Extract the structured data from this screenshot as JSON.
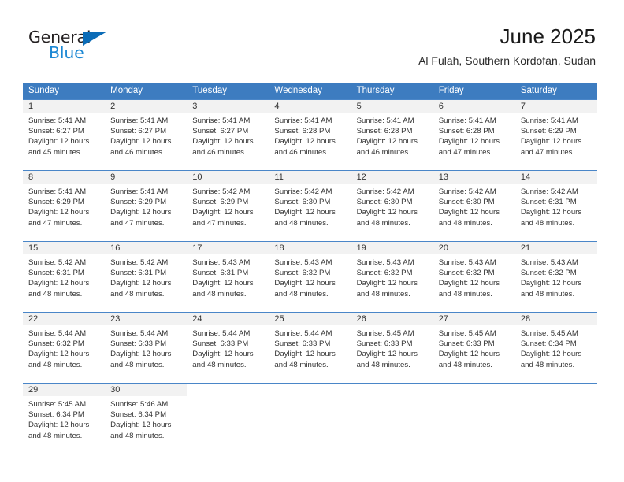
{
  "brand": {
    "name_part1": "General",
    "name_part2": "Blue",
    "triangle_icon": "triangle-icon",
    "accent_color": "#1c88d4"
  },
  "header": {
    "title": "June 2025",
    "subtitle": "Al Fulah, Southern Kordofan, Sudan"
  },
  "calendar": {
    "header_bg": "#3d7cc0",
    "daynum_bg": "#f2f2f2",
    "grid_line": "#4a86c8",
    "weekday_headers": [
      "Sunday",
      "Monday",
      "Tuesday",
      "Wednesday",
      "Thursday",
      "Friday",
      "Saturday"
    ],
    "weeks": [
      [
        {
          "day": "1",
          "sunrise": "Sunrise: 5:41 AM",
          "sunset": "Sunset: 6:27 PM",
          "daylight1": "Daylight: 12 hours",
          "daylight2": "and 45 minutes."
        },
        {
          "day": "2",
          "sunrise": "Sunrise: 5:41 AM",
          "sunset": "Sunset: 6:27 PM",
          "daylight1": "Daylight: 12 hours",
          "daylight2": "and 46 minutes."
        },
        {
          "day": "3",
          "sunrise": "Sunrise: 5:41 AM",
          "sunset": "Sunset: 6:27 PM",
          "daylight1": "Daylight: 12 hours",
          "daylight2": "and 46 minutes."
        },
        {
          "day": "4",
          "sunrise": "Sunrise: 5:41 AM",
          "sunset": "Sunset: 6:28 PM",
          "daylight1": "Daylight: 12 hours",
          "daylight2": "and 46 minutes."
        },
        {
          "day": "5",
          "sunrise": "Sunrise: 5:41 AM",
          "sunset": "Sunset: 6:28 PM",
          "daylight1": "Daylight: 12 hours",
          "daylight2": "and 46 minutes."
        },
        {
          "day": "6",
          "sunrise": "Sunrise: 5:41 AM",
          "sunset": "Sunset: 6:28 PM",
          "daylight1": "Daylight: 12 hours",
          "daylight2": "and 47 minutes."
        },
        {
          "day": "7",
          "sunrise": "Sunrise: 5:41 AM",
          "sunset": "Sunset: 6:29 PM",
          "daylight1": "Daylight: 12 hours",
          "daylight2": "and 47 minutes."
        }
      ],
      [
        {
          "day": "8",
          "sunrise": "Sunrise: 5:41 AM",
          "sunset": "Sunset: 6:29 PM",
          "daylight1": "Daylight: 12 hours",
          "daylight2": "and 47 minutes."
        },
        {
          "day": "9",
          "sunrise": "Sunrise: 5:41 AM",
          "sunset": "Sunset: 6:29 PM",
          "daylight1": "Daylight: 12 hours",
          "daylight2": "and 47 minutes."
        },
        {
          "day": "10",
          "sunrise": "Sunrise: 5:42 AM",
          "sunset": "Sunset: 6:29 PM",
          "daylight1": "Daylight: 12 hours",
          "daylight2": "and 47 minutes."
        },
        {
          "day": "11",
          "sunrise": "Sunrise: 5:42 AM",
          "sunset": "Sunset: 6:30 PM",
          "daylight1": "Daylight: 12 hours",
          "daylight2": "and 48 minutes."
        },
        {
          "day": "12",
          "sunrise": "Sunrise: 5:42 AM",
          "sunset": "Sunset: 6:30 PM",
          "daylight1": "Daylight: 12 hours",
          "daylight2": "and 48 minutes."
        },
        {
          "day": "13",
          "sunrise": "Sunrise: 5:42 AM",
          "sunset": "Sunset: 6:30 PM",
          "daylight1": "Daylight: 12 hours",
          "daylight2": "and 48 minutes."
        },
        {
          "day": "14",
          "sunrise": "Sunrise: 5:42 AM",
          "sunset": "Sunset: 6:31 PM",
          "daylight1": "Daylight: 12 hours",
          "daylight2": "and 48 minutes."
        }
      ],
      [
        {
          "day": "15",
          "sunrise": "Sunrise: 5:42 AM",
          "sunset": "Sunset: 6:31 PM",
          "daylight1": "Daylight: 12 hours",
          "daylight2": "and 48 minutes."
        },
        {
          "day": "16",
          "sunrise": "Sunrise: 5:42 AM",
          "sunset": "Sunset: 6:31 PM",
          "daylight1": "Daylight: 12 hours",
          "daylight2": "and 48 minutes."
        },
        {
          "day": "17",
          "sunrise": "Sunrise: 5:43 AM",
          "sunset": "Sunset: 6:31 PM",
          "daylight1": "Daylight: 12 hours",
          "daylight2": "and 48 minutes."
        },
        {
          "day": "18",
          "sunrise": "Sunrise: 5:43 AM",
          "sunset": "Sunset: 6:32 PM",
          "daylight1": "Daylight: 12 hours",
          "daylight2": "and 48 minutes."
        },
        {
          "day": "19",
          "sunrise": "Sunrise: 5:43 AM",
          "sunset": "Sunset: 6:32 PM",
          "daylight1": "Daylight: 12 hours",
          "daylight2": "and 48 minutes."
        },
        {
          "day": "20",
          "sunrise": "Sunrise: 5:43 AM",
          "sunset": "Sunset: 6:32 PM",
          "daylight1": "Daylight: 12 hours",
          "daylight2": "and 48 minutes."
        },
        {
          "day": "21",
          "sunrise": "Sunrise: 5:43 AM",
          "sunset": "Sunset: 6:32 PM",
          "daylight1": "Daylight: 12 hours",
          "daylight2": "and 48 minutes."
        }
      ],
      [
        {
          "day": "22",
          "sunrise": "Sunrise: 5:44 AM",
          "sunset": "Sunset: 6:32 PM",
          "daylight1": "Daylight: 12 hours",
          "daylight2": "and 48 minutes."
        },
        {
          "day": "23",
          "sunrise": "Sunrise: 5:44 AM",
          "sunset": "Sunset: 6:33 PM",
          "daylight1": "Daylight: 12 hours",
          "daylight2": "and 48 minutes."
        },
        {
          "day": "24",
          "sunrise": "Sunrise: 5:44 AM",
          "sunset": "Sunset: 6:33 PM",
          "daylight1": "Daylight: 12 hours",
          "daylight2": "and 48 minutes."
        },
        {
          "day": "25",
          "sunrise": "Sunrise: 5:44 AM",
          "sunset": "Sunset: 6:33 PM",
          "daylight1": "Daylight: 12 hours",
          "daylight2": "and 48 minutes."
        },
        {
          "day": "26",
          "sunrise": "Sunrise: 5:45 AM",
          "sunset": "Sunset: 6:33 PM",
          "daylight1": "Daylight: 12 hours",
          "daylight2": "and 48 minutes."
        },
        {
          "day": "27",
          "sunrise": "Sunrise: 5:45 AM",
          "sunset": "Sunset: 6:33 PM",
          "daylight1": "Daylight: 12 hours",
          "daylight2": "and 48 minutes."
        },
        {
          "day": "28",
          "sunrise": "Sunrise: 5:45 AM",
          "sunset": "Sunset: 6:34 PM",
          "daylight1": "Daylight: 12 hours",
          "daylight2": "and 48 minutes."
        }
      ],
      [
        {
          "day": "29",
          "sunrise": "Sunrise: 5:45 AM",
          "sunset": "Sunset: 6:34 PM",
          "daylight1": "Daylight: 12 hours",
          "daylight2": "and 48 minutes."
        },
        {
          "day": "30",
          "sunrise": "Sunrise: 5:46 AM",
          "sunset": "Sunset: 6:34 PM",
          "daylight1": "Daylight: 12 hours",
          "daylight2": "and 48 minutes."
        },
        {
          "day": "",
          "sunrise": "",
          "sunset": "",
          "daylight1": "",
          "daylight2": ""
        },
        {
          "day": "",
          "sunrise": "",
          "sunset": "",
          "daylight1": "",
          "daylight2": ""
        },
        {
          "day": "",
          "sunrise": "",
          "sunset": "",
          "daylight1": "",
          "daylight2": ""
        },
        {
          "day": "",
          "sunrise": "",
          "sunset": "",
          "daylight1": "",
          "daylight2": ""
        },
        {
          "day": "",
          "sunrise": "",
          "sunset": "",
          "daylight1": "",
          "daylight2": ""
        }
      ]
    ]
  }
}
